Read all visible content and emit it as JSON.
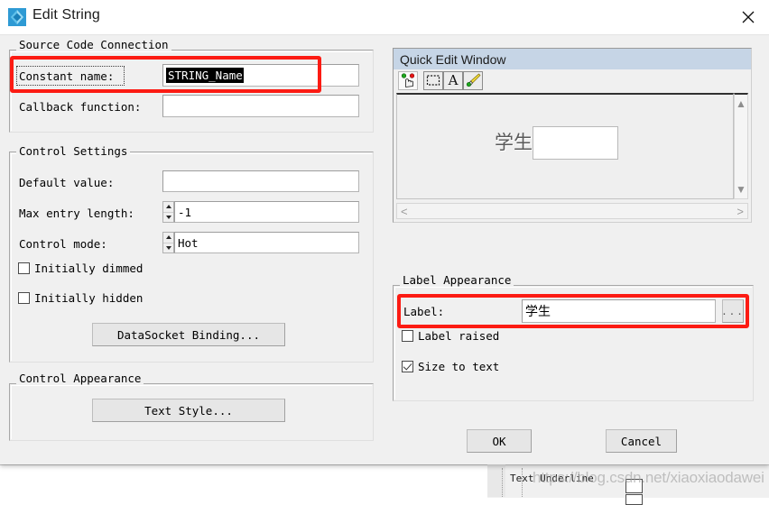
{
  "window": {
    "title": "Edit String",
    "icon": "labwindows-cvi-icon",
    "close_label": "close-icon"
  },
  "source_code_connection": {
    "title": "Source Code Connection",
    "constant_name_label": "Constant name:",
    "constant_name_value": "STRING_Name",
    "callback_function_label": "Callback function:",
    "callback_function_value": ""
  },
  "control_settings": {
    "title": "Control Settings",
    "default_value_label": "Default value:",
    "default_value": "",
    "max_entry_length_label": "Max entry length:",
    "max_entry_length_value": "-1",
    "control_mode_label": "Control mode:",
    "control_mode_value": "Hot",
    "initially_dimmed_label": "Initially dimmed",
    "initially_dimmed_checked": false,
    "initially_hidden_label": "Initially hidden",
    "initially_hidden_checked": false,
    "datasocket_button": "DataSocket Binding..."
  },
  "control_appearance": {
    "title": "Control Appearance",
    "text_style_button": "Text Style..."
  },
  "quick_edit_window": {
    "title": "Quick Edit Window",
    "tools": [
      {
        "name": "operate-tool-icon",
        "label": "Operate"
      },
      {
        "name": "select-rectangle-icon",
        "label": "Select"
      },
      {
        "name": "text-tool-icon",
        "label": "A"
      },
      {
        "name": "paintbrush-tool-icon",
        "label": "Paint"
      }
    ],
    "preview_label": "学生",
    "scroll_left": "<",
    "scroll_right": ">"
  },
  "label_appearance": {
    "title": "Label Appearance",
    "label_label": "Label:",
    "label_value": "学生",
    "browse_button": "...",
    "label_raised_label": "Label raised",
    "label_raised_checked": false,
    "size_to_text_label": "Size to text",
    "size_to_text_checked": true
  },
  "footer": {
    "ok_button": "OK",
    "cancel_button": "Cancel"
  },
  "background": {
    "row_label": "Text Underline",
    "watermark": "https://blog.csdn.net/xiaoxiaodawei"
  },
  "colors": {
    "annotation_red": "#fc1b13",
    "panel_header_blue": "#c6d5e6",
    "dialog_bg": "#f0f0f0",
    "selection_black": "#000000"
  }
}
